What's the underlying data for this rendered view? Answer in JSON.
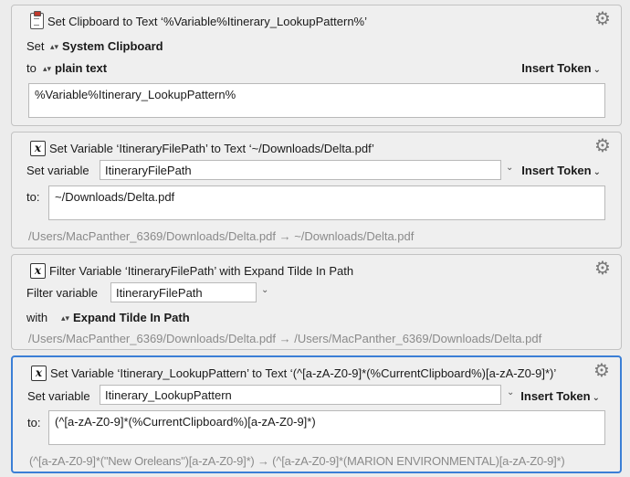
{
  "actions": [
    {
      "title": "Set Clipboard to Text ‘%Variable%Itinerary_LookupPattern%’",
      "set_label": "Set",
      "set_value": "System Clipboard",
      "to_label": "to",
      "to_value": "plain text",
      "insert_token": "Insert Token",
      "text": "%Variable%Itinerary_LookupPattern%"
    },
    {
      "title": "Set Variable ‘ItineraryFilePath’ to Text ‘~/Downloads/Delta.pdf’",
      "set_label": "Set variable",
      "var_name": "ItineraryFilePath",
      "insert_token": "Insert Token",
      "to_label": "to:",
      "text": "~/Downloads/Delta.pdf",
      "preview": "/Users/MacPanther_6369/Downloads/Delta.pdf → ~/Downloads/Delta.pdf"
    },
    {
      "title": "Filter Variable ‘ItineraryFilePath’ with Expand Tilde In Path",
      "filter_label": "Filter variable",
      "var_name": "ItineraryFilePath",
      "with_label": "with",
      "with_value": "Expand Tilde In Path",
      "preview": "/Users/MacPanther_6369/Downloads/Delta.pdf → /Users/MacPanther_6369/Downloads/Delta.pdf"
    },
    {
      "title": "Set Variable ‘Itinerary_LookupPattern’ to Text ‘(^[a-zA-Z0-9]*(%CurrentClipboard%)[a-zA-Z0-9]*)’",
      "set_label": "Set variable",
      "var_name": "Itinerary_LookupPattern",
      "insert_token": "Insert Token",
      "to_label": "to:",
      "text": "(^[a-zA-Z0-9]*(%CurrentClipboard%)[a-zA-Z0-9]*)",
      "preview": "(^[a-zA-Z0-9]*(\"New Oreleans\")[a-zA-Z0-9]*) → (^[a-zA-Z0-9]*(MARION ENVIRONMENTAL)[a-zA-Z0-9]*)"
    }
  ],
  "icons": {
    "gear": "⚙",
    "updown": "▴▾",
    "chevron": "⌄",
    "var_glyph": "x"
  }
}
